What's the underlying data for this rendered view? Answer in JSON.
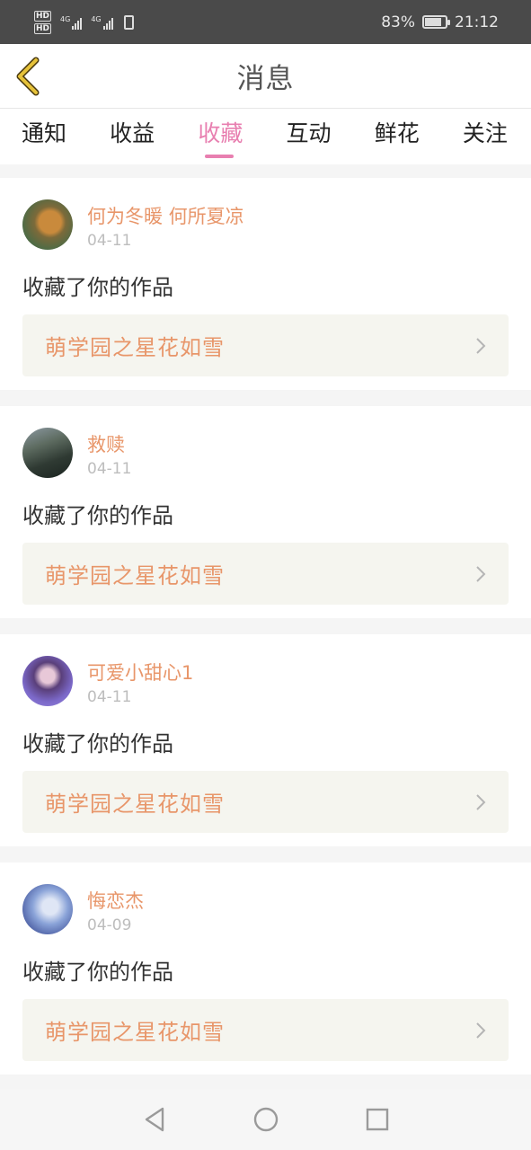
{
  "status": {
    "hd1": "HD",
    "hd2": "HD",
    "net1": "4G",
    "net2": "4G",
    "battery": "83%",
    "battery_level": 0.83,
    "time": "21:12"
  },
  "header": {
    "title": "消息",
    "back_icon": "chevron-left-icon"
  },
  "tabs": [
    {
      "label": "通知",
      "active": false
    },
    {
      "label": "收益",
      "active": false
    },
    {
      "label": "收藏",
      "active": true
    },
    {
      "label": "互动",
      "active": false
    },
    {
      "label": "鲜花",
      "active": false
    },
    {
      "label": "关注",
      "active": false
    }
  ],
  "colors": {
    "accent": "#e87fb0",
    "username": "#e8966a",
    "date": "#bdbdbd",
    "link_bg": "#f5f5ef"
  },
  "messages": [
    {
      "user": "何为冬暖 何所夏凉",
      "date": "04-11",
      "action": "收藏了你的作品",
      "work": "萌学园之星花如雪"
    },
    {
      "user": "救赎",
      "date": "04-11",
      "action": "收藏了你的作品",
      "work": "萌学园之星花如雪"
    },
    {
      "user": "可爱小甜心1",
      "date": "04-11",
      "action": "收藏了你的作品",
      "work": "萌学园之星花如雪"
    },
    {
      "user": "悔恋杰",
      "date": "04-09",
      "action": "收藏了你的作品",
      "work": "萌学园之星花如雪"
    }
  ],
  "navbar": {
    "back_icon": "triangle-back-icon",
    "home_icon": "circle-home-icon",
    "recents_icon": "square-recents-icon"
  }
}
